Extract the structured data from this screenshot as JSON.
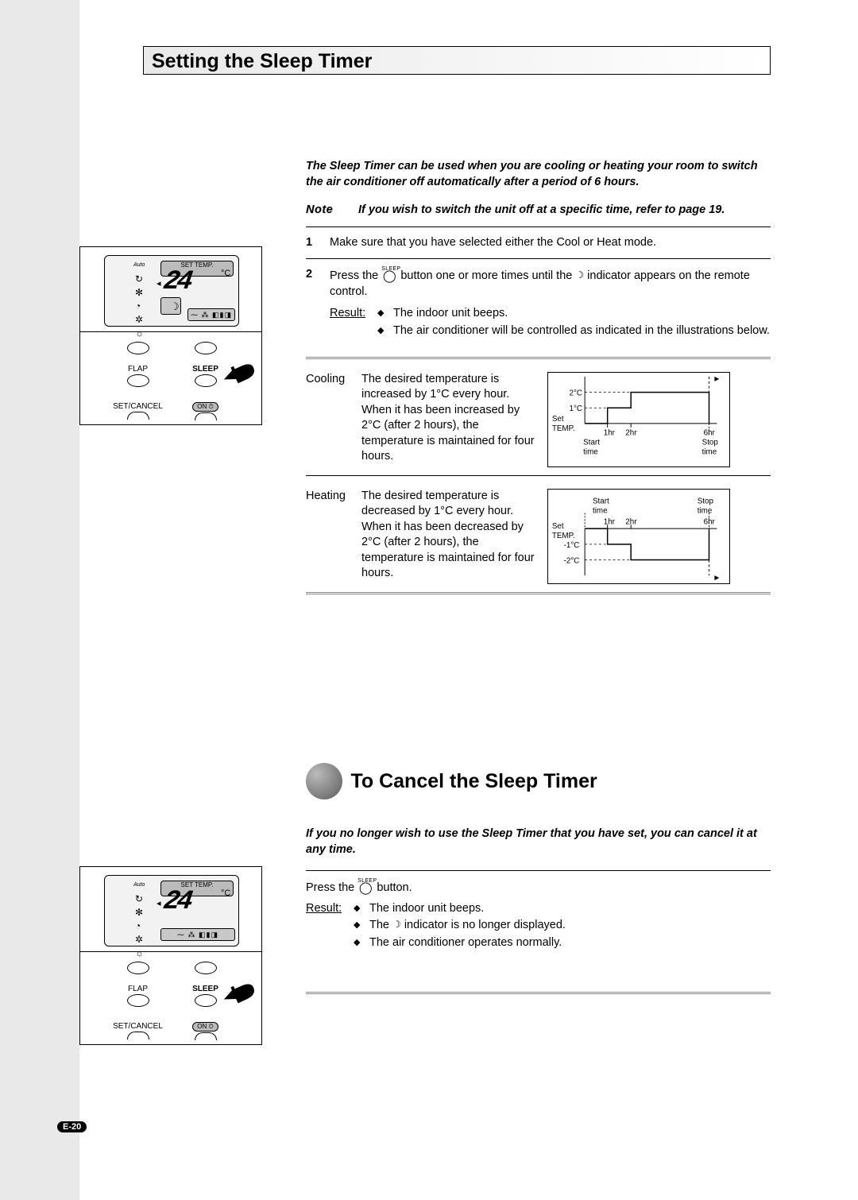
{
  "page_number_prefix": "E-",
  "page_number": "20",
  "title": "Setting the Sleep Timer",
  "intro": "The Sleep Timer can be used when you are cooling or heating your room to switch the air conditioner off automatically after a period of 6 hours.",
  "note_label": "Note",
  "note_text": "If you wish to switch the unit off at a specific time, refer to page 19.",
  "step1": {
    "num": "1",
    "text": "Make sure that you have selected either the Cool or Heat mode."
  },
  "step2": {
    "num": "2",
    "text_a": "Press the ",
    "text_b": " button one or more times until the ",
    "text_c": " indicator appears on the remote control.",
    "sleep_label": "SLEEP"
  },
  "result_label": "Result:",
  "step2_results": [
    "The indoor unit beeps.",
    "The air conditioner will be controlled as indicated in the illustrations below."
  ],
  "cooling": {
    "label": "Cooling",
    "text": "The desired temperature is increased by 1°C every hour. When it has been increased by 2°C (after 2 hours), the temperature is maintained for four hours."
  },
  "heating": {
    "label": "Heating",
    "text": "The desired temperature is decreased by 1°C every hour. When it has been decreased by 2°C (after 2 hours), the temperature is maintained for four hours."
  },
  "chart_data": [
    {
      "type": "line",
      "title": "Cooling sleep-timer profile",
      "x_unit": "hr",
      "x": [
        0,
        1,
        2,
        6
      ],
      "y_unit": "°C (offset from set temp)",
      "y": [
        0,
        1,
        2,
        2
      ],
      "y_ticks": [
        "1°C",
        "2°C"
      ],
      "x_ticks": [
        "1hr",
        "2hr",
        "6hr"
      ],
      "y_axis_label_lines": [
        "Set",
        "TEMP."
      ],
      "left_time_label_lines": [
        "Start",
        "time"
      ],
      "right_time_label_lines": [
        "Stop",
        "time"
      ]
    },
    {
      "type": "line",
      "title": "Heating sleep-timer profile",
      "x_unit": "hr",
      "x": [
        0,
        1,
        2,
        6
      ],
      "y_unit": "°C (offset from set temp)",
      "y": [
        0,
        -1,
        -2,
        -2
      ],
      "y_ticks": [
        "-1°C",
        "-2°C"
      ],
      "x_ticks": [
        "1hr",
        "2hr",
        "6hr"
      ],
      "y_axis_label_lines": [
        "Set",
        "TEMP."
      ],
      "left_time_label_lines": [
        "Start",
        "time"
      ],
      "right_time_label_lines": [
        "Stop",
        "time"
      ]
    }
  ],
  "section2_title": "To Cancel the Sleep Timer",
  "intro2": "If you no longer wish to use the Sleep Timer that you have set, you can cancel it at any time.",
  "cancel_line_a": "Press the ",
  "cancel_line_b": " button.",
  "cancel_results": [
    "The indoor unit beeps.",
    "The   indicator is no longer displayed.",
    "The air conditioner operates normally."
  ],
  "cancel_result2_a": "The ",
  "cancel_result2_b": " indicator is no longer displayed.",
  "remote": {
    "set_temp_label": "SET TEMP.",
    "temperature": "24",
    "deg": "°C",
    "auto": "Auto",
    "flap": "FLAP",
    "sleep": "SLEEP",
    "set_cancel": "SET/CANCEL",
    "on": "ON ⏱"
  }
}
